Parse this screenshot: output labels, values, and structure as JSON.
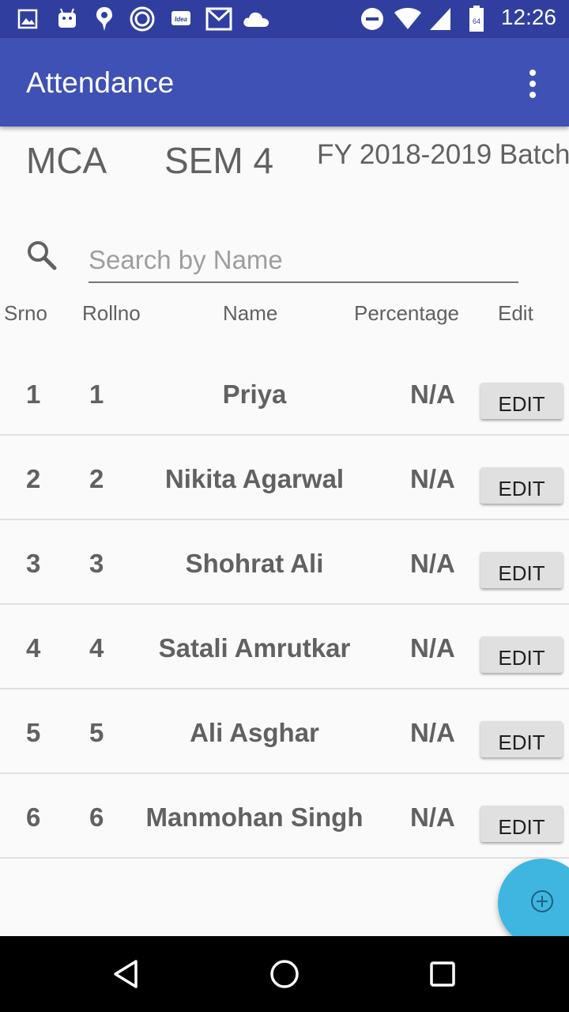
{
  "status_bar": {
    "time": "12:26",
    "icons": [
      "gallery-icon",
      "android-icon",
      "notification-icon",
      "vodafone-icon",
      "idea-icon",
      "gmail-icon",
      "cloud-icon",
      "dnd-icon",
      "wifi-icon",
      "signal-icon",
      "battery-icon"
    ],
    "idea_label": "Idea",
    "battery_level": "64"
  },
  "app_bar": {
    "title": "Attendance"
  },
  "class_info": {
    "course": "MCA",
    "semester": "SEM 4",
    "batch": "FY 2018-2019 Batch"
  },
  "search": {
    "placeholder": "Search by Name",
    "value": ""
  },
  "columns": {
    "srno": "Srno",
    "rollno": "Rollno",
    "name": "Name",
    "percentage": "Percentage",
    "edit": "Edit"
  },
  "students": [
    {
      "srno": "1",
      "rollno": "1",
      "name": "Priya",
      "percentage": "N/A",
      "edit_label": "EDIT"
    },
    {
      "srno": "2",
      "rollno": "2",
      "name": "Nikita Agarwal",
      "percentage": "N/A",
      "edit_label": "EDIT"
    },
    {
      "srno": "3",
      "rollno": "3",
      "name": "Shohrat Ali",
      "percentage": "N/A",
      "edit_label": "EDIT"
    },
    {
      "srno": "4",
      "rollno": "4",
      "name": "Satali Amrutkar",
      "percentage": "N/A",
      "edit_label": "EDIT"
    },
    {
      "srno": "5",
      "rollno": "5",
      "name": "Ali Asghar",
      "percentage": "N/A",
      "edit_label": "EDIT"
    },
    {
      "srno": "6",
      "rollno": "6",
      "name": "Manmohan Singh",
      "percentage": "N/A",
      "edit_label": "EDIT"
    }
  ],
  "colors": {
    "primary": "#3f51b5",
    "primary_dark": "#303f9f",
    "fab": "#3fb6e0",
    "text": "#616161"
  }
}
